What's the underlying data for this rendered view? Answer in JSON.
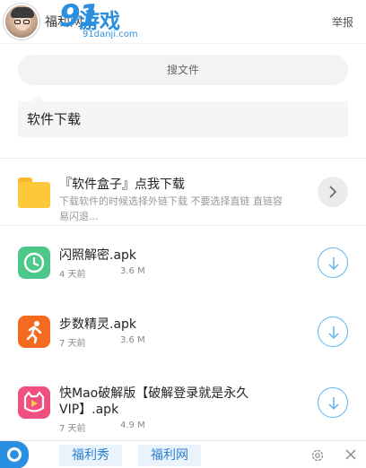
{
  "header": {
    "title": "福利网",
    "brand_number": "91",
    "brand_text": "游戏",
    "brand_url": "91danji.com",
    "report_label": "举报",
    "avatar_icon": "user-avatar"
  },
  "search": {
    "placeholder": "搜文件"
  },
  "section": {
    "title": "软件下载"
  },
  "folder": {
    "title": "『软件盒子』点我下载",
    "description": "下载软件的时候选择外链下载 不要选择直链 直链容易闪退...",
    "icon": "folder-icon",
    "action_icon": "chevron-right-icon"
  },
  "apps": [
    {
      "name": "闪照解密.apk",
      "age": "4 天前",
      "size": "3.6 M",
      "icon": "clock-app-icon",
      "color": "#4cc98a",
      "action_icon": "download-icon"
    },
    {
      "name": "步数精灵.apk",
      "age": "7 天前",
      "size": "3.6 M",
      "icon": "runner-app-icon",
      "color": "#f36a21",
      "action_icon": "download-icon"
    },
    {
      "name": "快Mao破解版【破解登录就是永久VIP】.apk",
      "age": "7 天前",
      "size": "4.9 M",
      "icon": "cat-app-icon",
      "color": "#f0507f",
      "action_icon": "download-icon"
    }
  ],
  "footer": {
    "tabs": [
      "福利秀",
      "福利网"
    ],
    "logo_icon": "qq-logo-icon",
    "settings_icon": "gear-icon",
    "close_icon": "close-icon"
  },
  "colors": {
    "accent": "#2a8fe0",
    "download_ring": "#5bb5f0",
    "folder": "#fdc93b"
  }
}
